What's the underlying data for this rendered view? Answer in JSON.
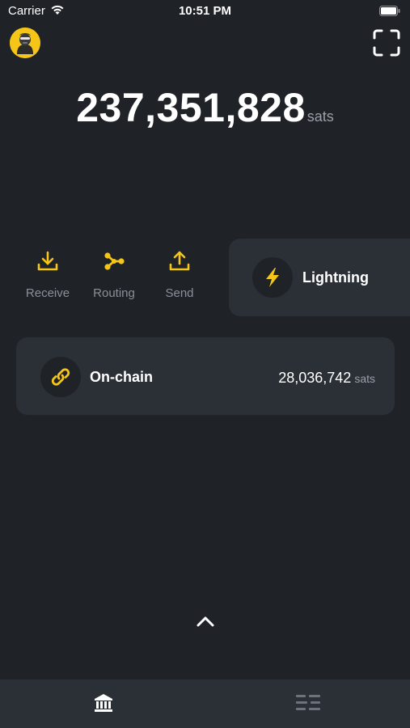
{
  "status_bar": {
    "carrier": "Carrier",
    "time": "10:51 PM"
  },
  "header": {
    "avatar_icon": "avatar-icon",
    "scan_icon": "scan-icon"
  },
  "balance": {
    "value": "237,351,828",
    "unit": "sats"
  },
  "actions": [
    {
      "label": "Receive",
      "icon": "download-icon"
    },
    {
      "label": "Routing",
      "icon": "routing-icon"
    },
    {
      "label": "Send",
      "icon": "upload-icon"
    }
  ],
  "cards": {
    "lightning": {
      "title": "Lightning",
      "icon": "lightning-icon"
    },
    "onchain": {
      "title": "On-chain",
      "amount": "28,036,742",
      "unit": "sats",
      "icon": "link-icon"
    }
  },
  "bottom_nav": {
    "wallet_icon": "bank-icon",
    "activity_icon": "list-icon"
  },
  "colors": {
    "background": "#1f2227",
    "card": "#2b2f36",
    "accent": "#f5c518",
    "muted": "#8b9098"
  }
}
